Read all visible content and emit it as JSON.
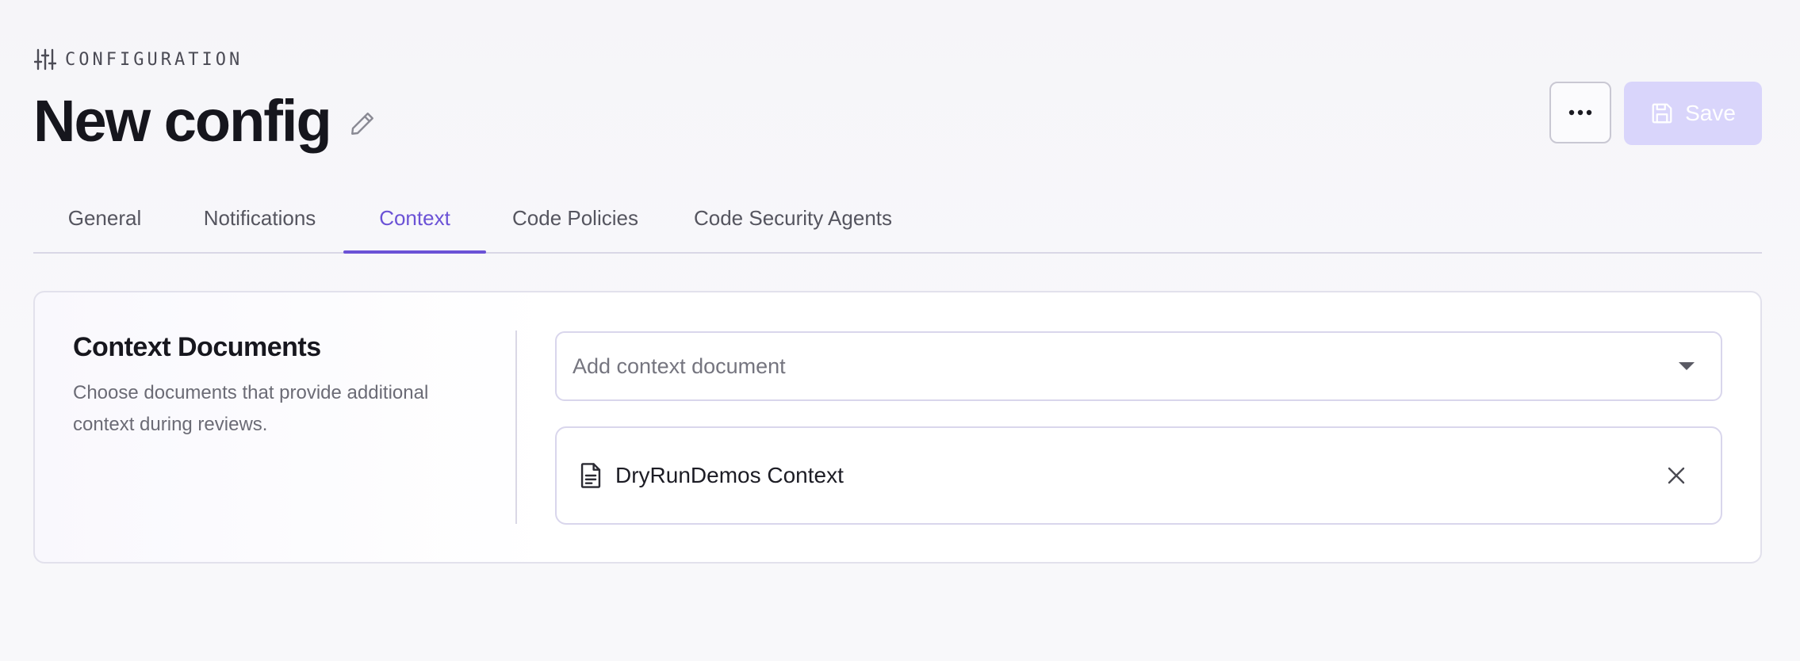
{
  "header": {
    "eyebrow": "CONFIGURATION",
    "eyebrow_icon": "sliders-icon",
    "title": "New config",
    "edit_icon": "pencil-icon"
  },
  "actions": {
    "more_icon": "ellipsis-icon",
    "save_label": "Save",
    "save_icon": "floppy-disk-icon",
    "save_enabled": false
  },
  "tabs": [
    {
      "label": "General",
      "active": false
    },
    {
      "label": "Notifications",
      "active": false
    },
    {
      "label": "Context",
      "active": true
    },
    {
      "label": "Code Policies",
      "active": false
    },
    {
      "label": "Code Security Agents",
      "active": false
    }
  ],
  "context_documents": {
    "title": "Context Documents",
    "description": "Choose documents that provide additional context during reviews.",
    "select": {
      "placeholder": "Add context document",
      "icon": "caret-down-icon"
    },
    "documents": [
      {
        "name": "DryRunDemos Context",
        "icon": "document-icon",
        "remove_icon": "close-icon"
      }
    ]
  },
  "colors": {
    "accent": "#6b52d6",
    "save_disabled_bg": "#d9d5fb",
    "border": "#d9d6ec"
  }
}
